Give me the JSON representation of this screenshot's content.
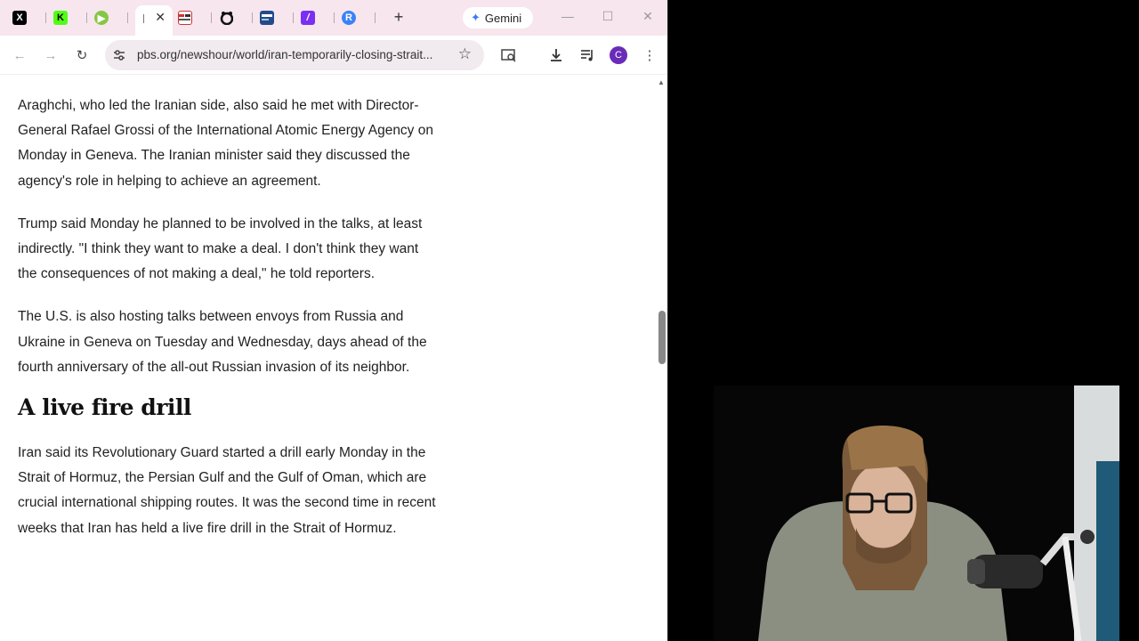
{
  "browser": {
    "tabs": [
      {
        "icon": "x-icon",
        "glyph": "X"
      },
      {
        "icon": "kick-icon",
        "glyph": "K"
      },
      {
        "icon": "rumble-icon",
        "glyph": "▶"
      },
      {
        "icon": "pbs-tab-icon",
        "glyph": "",
        "active": true
      },
      {
        "icon": "news-icon",
        "glyph": ""
      },
      {
        "icon": "game-icon",
        "glyph": ""
      },
      {
        "icon": "doc-icon",
        "glyph": ""
      },
      {
        "icon": "slash-icon",
        "glyph": "/"
      },
      {
        "icon": "r-icon",
        "glyph": "R"
      }
    ],
    "gemini_label": "Gemini",
    "url": "pbs.org/newshour/world/iran-temporarily-closing-strait...",
    "profile_initial": "C"
  },
  "article": {
    "paragraphs": [
      "Araghchi, who led the Iranian side, also said he met with Director-General Rafael Grossi of the International Atomic Energy Agency on Monday in Geneva. The Iranian minister said they discussed the agency's role in helping to achieve an agreement.",
      "Trump said Monday he planned to be involved in the talks, at least indirectly. \"I think they want to make a deal. I don't think they want the consequences of not making a deal,\" he told reporters.",
      "The U.S. is also hosting talks between envoys from Russia and Ukraine in Geneva on Tuesday and Wednesday, days ahead of the fourth anniversary of the all-out Russian invasion of its neighbor."
    ],
    "heading": "A live fire drill",
    "paragraph_after": "Iran said its Revolutionary Guard started a drill early Monday in the Strait of Hormuz, the Persian Gulf and the Gulf of Oman, which are crucial international shipping routes. It was the second time in recent weeks that Iran has held a live fire drill in the Strait of Hormuz."
  },
  "scroll_position": 0.45
}
